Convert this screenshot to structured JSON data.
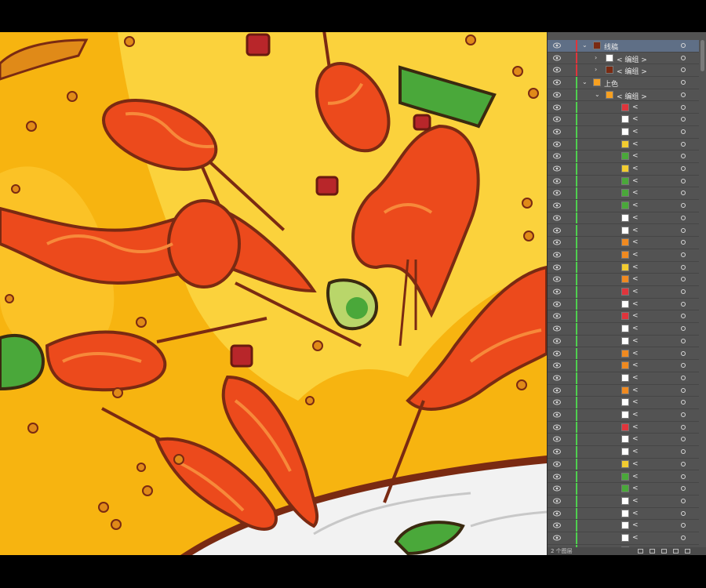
{
  "colors": {
    "bg": "#f7b410",
    "bg_light": "#fbd23c",
    "crayfish": "#ec4a1c",
    "crayfish_highlight": "#f7893a",
    "outline": "#7a2a12",
    "lime": "#4aa83a",
    "plate": "#f2f2f2",
    "panel": "#535353",
    "selected_row": "#5f6f86",
    "layer_red": "#e0353c",
    "layer_green": "#4fd04f"
  },
  "layers": {
    "rows": [
      {
        "label": "线稿",
        "level": 0,
        "expanded": true,
        "color": "red",
        "selected": true,
        "thumb": "dark"
      },
      {
        "label": "< 编组 >",
        "level": 1,
        "expanded": false,
        "color": "red",
        "thumb": "bar"
      },
      {
        "label": "< 编组 >",
        "level": 1,
        "expanded": false,
        "color": "red",
        "thumb": "dark"
      },
      {
        "label": "上色",
        "level": 0,
        "expanded": true,
        "color": "green",
        "thumb": "orange"
      },
      {
        "label": "< 编组 >",
        "level": 1,
        "expanded": true,
        "color": "green",
        "thumb": "orange"
      },
      {
        "label": "<",
        "level": 2,
        "color": "green",
        "thumb": "red-dot"
      },
      {
        "label": "<",
        "level": 2,
        "color": "green",
        "thumb": "white"
      },
      {
        "label": "<",
        "level": 2,
        "color": "green",
        "thumb": "white"
      },
      {
        "label": "<",
        "level": 2,
        "color": "green",
        "thumb": "yellow-bar"
      },
      {
        "label": "<",
        "level": 2,
        "color": "green",
        "thumb": "green-leaf"
      },
      {
        "label": "<",
        "level": 2,
        "color": "green",
        "thumb": "yellow-bar"
      },
      {
        "label": "<",
        "level": 2,
        "color": "green",
        "thumb": "green-leaf"
      },
      {
        "label": "<",
        "level": 2,
        "color": "green",
        "thumb": "green-leaf"
      },
      {
        "label": "<",
        "level": 2,
        "color": "green",
        "thumb": "green-leaf"
      },
      {
        "label": "<",
        "level": 2,
        "color": "green",
        "thumb": "white"
      },
      {
        "label": "<",
        "level": 2,
        "color": "green",
        "thumb": "white"
      },
      {
        "label": "<",
        "level": 2,
        "color": "green",
        "thumb": "orange-bar"
      },
      {
        "label": "<",
        "level": 2,
        "color": "green",
        "thumb": "orange-bar"
      },
      {
        "label": "<",
        "level": 2,
        "color": "green",
        "thumb": "yellow-bar"
      },
      {
        "label": "<",
        "level": 2,
        "color": "green",
        "thumb": "orange-tri"
      },
      {
        "label": "<",
        "level": 2,
        "color": "green",
        "thumb": "red-dot"
      },
      {
        "label": "<",
        "level": 2,
        "color": "green",
        "thumb": "white"
      },
      {
        "label": "<",
        "level": 2,
        "color": "green",
        "thumb": "red-dot"
      },
      {
        "label": "<",
        "level": 2,
        "color": "green",
        "thumb": "white"
      },
      {
        "label": "<",
        "level": 2,
        "color": "green",
        "thumb": "white"
      },
      {
        "label": "<",
        "level": 2,
        "color": "green",
        "thumb": "orange-tri"
      },
      {
        "label": "<",
        "level": 2,
        "color": "green",
        "thumb": "orange-bar"
      },
      {
        "label": "<",
        "level": 2,
        "color": "green",
        "thumb": "white"
      },
      {
        "label": "<",
        "level": 2,
        "color": "green",
        "thumb": "orange-bar"
      },
      {
        "label": "<",
        "level": 2,
        "color": "green",
        "thumb": "white"
      },
      {
        "label": "<",
        "level": 2,
        "color": "green",
        "thumb": "white"
      },
      {
        "label": "<",
        "level": 2,
        "color": "green",
        "thumb": "red-dot"
      },
      {
        "label": "<",
        "level": 2,
        "color": "green",
        "thumb": "white"
      },
      {
        "label": "<",
        "level": 2,
        "color": "green",
        "thumb": "white"
      },
      {
        "label": "<",
        "level": 2,
        "color": "green",
        "thumb": "yellow-bar"
      },
      {
        "label": "<",
        "level": 2,
        "color": "green",
        "thumb": "green-leaf"
      },
      {
        "label": "<",
        "level": 2,
        "color": "green",
        "thumb": "green-leaf"
      },
      {
        "label": "<",
        "level": 2,
        "color": "green",
        "thumb": "white"
      },
      {
        "label": "<",
        "level": 2,
        "color": "green",
        "thumb": "white"
      },
      {
        "label": "<",
        "level": 2,
        "color": "green",
        "thumb": "white"
      },
      {
        "label": "<",
        "level": 2,
        "color": "green",
        "thumb": "white"
      },
      {
        "label": "<",
        "level": 2,
        "color": "green",
        "thumb": "white"
      }
    ],
    "footer": "2 个图层"
  }
}
